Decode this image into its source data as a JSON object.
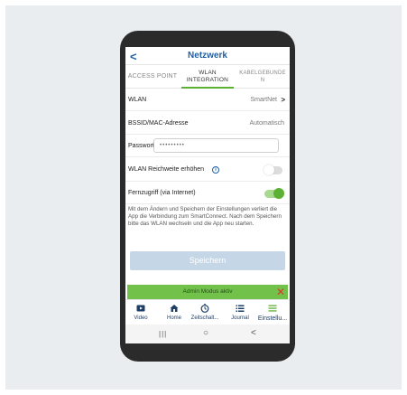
{
  "header": {
    "back": "<",
    "title": "Netzwerk"
  },
  "tabs": [
    {
      "line1": "ACCESS POINT",
      "line2": ""
    },
    {
      "line1": "WLAN",
      "line2": "INTEGRATION"
    },
    {
      "line1": "KABELGEBUNDE",
      "line2": "N"
    }
  ],
  "rows": {
    "wlan": {
      "label": "WLAN",
      "value": "SmartNet",
      "chevron": ">"
    },
    "bssid": {
      "label": "BSSID/MAC-Adresse",
      "value": "Automatisch"
    },
    "password": {
      "label": "Passwort",
      "value": "•••••••••"
    },
    "range": {
      "label": "WLAN Reichweite erhöhen",
      "info": "i"
    },
    "remote": {
      "label": "Fernzugriff (via Internet)"
    }
  },
  "note": "Mit dem Ändern und Speichern der Einstellungen verliert die App die Verbindung zum SmartConnect. Nach dem Speichern bitte das WLAN wechseln und die App neu starten.",
  "save_label": "Speichern",
  "admin": {
    "label": "Admin Modus aktiv",
    "close": "✕"
  },
  "nav": [
    {
      "label": "Video"
    },
    {
      "label": "Home"
    },
    {
      "label": "Zeitschalt..."
    },
    {
      "label": "Journal"
    },
    {
      "label": "Einstellu..."
    }
  ],
  "system_nav": {
    "recents": "|||",
    "home": "○",
    "back": "<"
  },
  "colors": {
    "brand": "#1f5fa6",
    "accent_green": "#5cb135",
    "save_disabled": "#c5d7e6",
    "admin_bar": "#72c14b",
    "close_red": "#e0352b"
  }
}
